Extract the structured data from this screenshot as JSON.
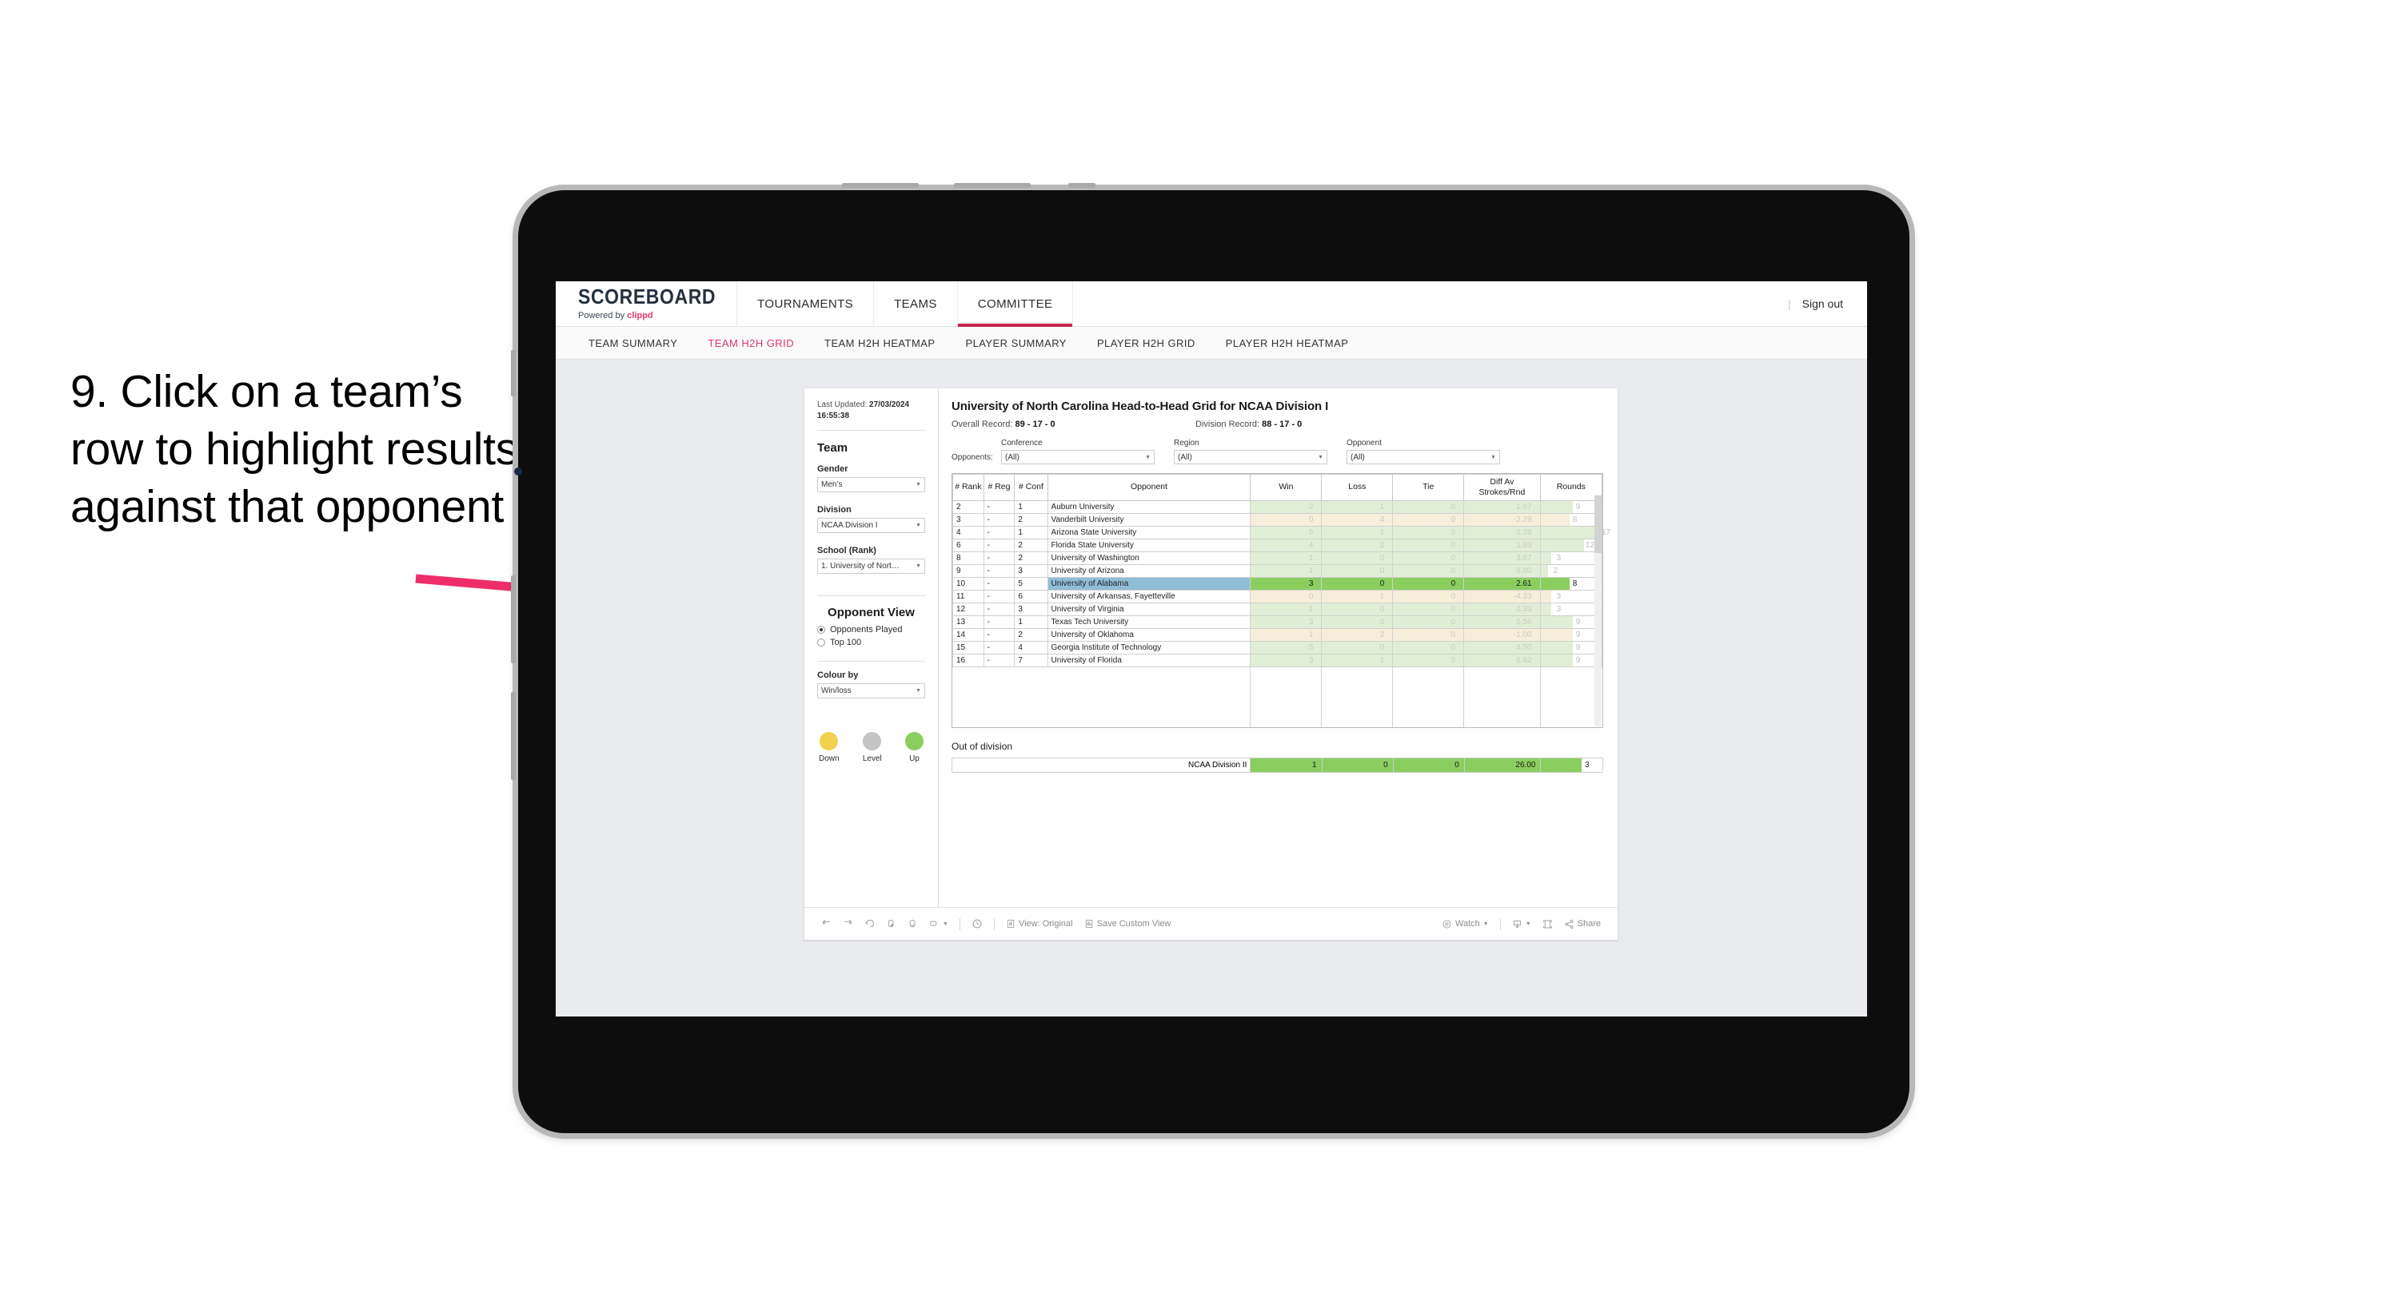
{
  "annotation": {
    "text": "9. Click on a team’s row to highlight results against that opponent",
    "arrow_color": "#ef2d6a"
  },
  "app": {
    "brand": {
      "title": "SCOREBOARD",
      "powered_prefix": "Powered by ",
      "powered_brand": "clippd"
    },
    "top_nav": [
      {
        "label": "TOURNAMENTS",
        "active": false
      },
      {
        "label": "TEAMS",
        "active": false
      },
      {
        "label": "COMMITTEE",
        "active": true
      }
    ],
    "account": {
      "separator": "|",
      "sign_out": "Sign out"
    },
    "sub_nav": [
      {
        "label": "TEAM SUMMARY",
        "active": false
      },
      {
        "label": "TEAM H2H GRID",
        "active": true
      },
      {
        "label": "TEAM H2H HEATMAP",
        "active": false
      },
      {
        "label": "PLAYER SUMMARY",
        "active": false
      },
      {
        "label": "PLAYER H2H GRID",
        "active": false
      },
      {
        "label": "PLAYER H2H HEATMAP",
        "active": false
      }
    ]
  },
  "sidebar": {
    "last_updated_label": "Last Updated:",
    "last_updated_value": "27/03/2024 16:55:38",
    "team_section": "Team",
    "gender": {
      "label": "Gender",
      "value": "Men’s"
    },
    "division": {
      "label": "Division",
      "value": "NCAA Division I"
    },
    "school": {
      "label": "School (Rank)",
      "value": "1. University of Nort…"
    },
    "opponent_view": {
      "title": "Opponent View",
      "options": [
        {
          "label": "Opponents Played",
          "selected": true
        },
        {
          "label": "Top 100",
          "selected": false
        }
      ]
    },
    "colour_by": {
      "label": "Colour by",
      "value": "Win/loss"
    },
    "legend": [
      {
        "label": "Down",
        "color": "#f1d14e"
      },
      {
        "label": "Level",
        "color": "#c4c4c4"
      },
      {
        "label": "Up",
        "color": "#8ace5f"
      }
    ]
  },
  "main": {
    "title": "University of North Carolina Head-to-Head Grid for NCAA Division I",
    "overall_record_label": "Overall Record:",
    "overall_record_value": "89 - 17 - 0",
    "division_record_label": "Division Record:",
    "division_record_value": "88 - 17 - 0",
    "opponents_label": "Opponents:",
    "filters": [
      {
        "label": "Conference",
        "value": "(All)"
      },
      {
        "label": "Region",
        "value": "(All)"
      },
      {
        "label": "Opponent",
        "value": "(All)"
      }
    ]
  },
  "chart_data": {
    "type": "table",
    "title": "University of North Carolina Head-to-Head Grid for NCAA Division I",
    "columns": [
      "# Rank",
      "# Reg",
      "# Conf",
      "Opponent",
      "Win",
      "Loss",
      "Tie",
      "Diff Av Strokes/Rnd",
      "Rounds"
    ],
    "rows": [
      {
        "rank": "2",
        "reg": "-",
        "conf": "1",
        "opponent": "Auburn University",
        "win": "2",
        "loss": "1",
        "tie": "0",
        "diff": "1.67",
        "rounds": "9",
        "result": "up",
        "selected": false
      },
      {
        "rank": "3",
        "reg": "-",
        "conf": "2",
        "opponent": "Vanderbilt University",
        "win": "0",
        "loss": "4",
        "tie": "0",
        "diff": "-2.29",
        "rounds": "8",
        "result": "down",
        "selected": false
      },
      {
        "rank": "4",
        "reg": "-",
        "conf": "1",
        "opponent": "Arizona State University",
        "win": "5",
        "loss": "1",
        "tie": "0",
        "diff": "2.28",
        "rounds": "17",
        "result": "up",
        "selected": false
      },
      {
        "rank": "6",
        "reg": "-",
        "conf": "2",
        "opponent": "Florida State University",
        "win": "4",
        "loss": "2",
        "tie": "0",
        "diff": "1.83",
        "rounds": "12",
        "result": "up",
        "selected": false
      },
      {
        "rank": "8",
        "reg": "-",
        "conf": "2",
        "opponent": "University of Washington",
        "win": "1",
        "loss": "0",
        "tie": "0",
        "diff": "3.67",
        "rounds": "3",
        "result": "up",
        "selected": false
      },
      {
        "rank": "9",
        "reg": "-",
        "conf": "3",
        "opponent": "University of Arizona",
        "win": "1",
        "loss": "0",
        "tie": "0",
        "diff": "9.00",
        "rounds": "2",
        "result": "up",
        "selected": false
      },
      {
        "rank": "10",
        "reg": "-",
        "conf": "5",
        "opponent": "University of Alabama",
        "win": "3",
        "loss": "0",
        "tie": "0",
        "diff": "2.61",
        "rounds": "8",
        "result": "up",
        "selected": true
      },
      {
        "rank": "11",
        "reg": "-",
        "conf": "6",
        "opponent": "University of Arkansas, Fayetteville",
        "win": "0",
        "loss": "1",
        "tie": "0",
        "diff": "-4.33",
        "rounds": "3",
        "result": "down",
        "selected": false
      },
      {
        "rank": "12",
        "reg": "-",
        "conf": "3",
        "opponent": "University of Virginia",
        "win": "1",
        "loss": "0",
        "tie": "0",
        "diff": "2.33",
        "rounds": "3",
        "result": "up",
        "selected": false
      },
      {
        "rank": "13",
        "reg": "-",
        "conf": "1",
        "opponent": "Texas Tech University",
        "win": "3",
        "loss": "0",
        "tie": "0",
        "diff": "5.56",
        "rounds": "9",
        "result": "up",
        "selected": false
      },
      {
        "rank": "14",
        "reg": "-",
        "conf": "2",
        "opponent": "University of Oklahoma",
        "win": "1",
        "loss": "2",
        "tie": "0",
        "diff": "-1.00",
        "rounds": "9",
        "result": "down",
        "selected": false
      },
      {
        "rank": "15",
        "reg": "-",
        "conf": "4",
        "opponent": "Georgia Institute of Technology",
        "win": "5",
        "loss": "0",
        "tie": "0",
        "diff": "4.50",
        "rounds": "9",
        "result": "up",
        "selected": false
      },
      {
        "rank": "16",
        "reg": "-",
        "conf": "7",
        "opponent": "University of Florida",
        "win": "3",
        "loss": "1",
        "tie": "0",
        "diff": "6.62",
        "rounds": "9",
        "result": "up",
        "selected": false
      }
    ],
    "out_of_division": {
      "title": "Out of division",
      "rows": [
        {
          "label": "NCAA Division II",
          "win": "1",
          "loss": "0",
          "tie": "0",
          "diff": "26.00",
          "rounds": "3",
          "result": "up"
        }
      ]
    },
    "colors": {
      "up": "#8ace5f",
      "down": "#f3e2b6",
      "selected_row": "#8fbdd6",
      "accent": "#e0366b"
    }
  },
  "toolbar": {
    "items": [
      {
        "icon": "undo-icon",
        "label": ""
      },
      {
        "icon": "redo-icon",
        "label": ""
      },
      {
        "icon": "revert-icon",
        "label": ""
      },
      {
        "icon": "refresh-icon",
        "label": ""
      },
      {
        "icon": "pause-icon",
        "label": ""
      },
      {
        "icon": "highlight-icon",
        "label": ""
      },
      {
        "icon": "clock-icon",
        "label": ""
      },
      {
        "icon": "view-original-icon",
        "label": "View: Original"
      },
      {
        "icon": "save-custom-view-icon",
        "label": "Save Custom View"
      },
      {
        "icon": "watch-icon",
        "label": "Watch"
      },
      {
        "icon": "download-icon",
        "label": ""
      },
      {
        "icon": "fullscreen-icon",
        "label": ""
      },
      {
        "icon": "share-icon",
        "label": "Share"
      }
    ]
  }
}
